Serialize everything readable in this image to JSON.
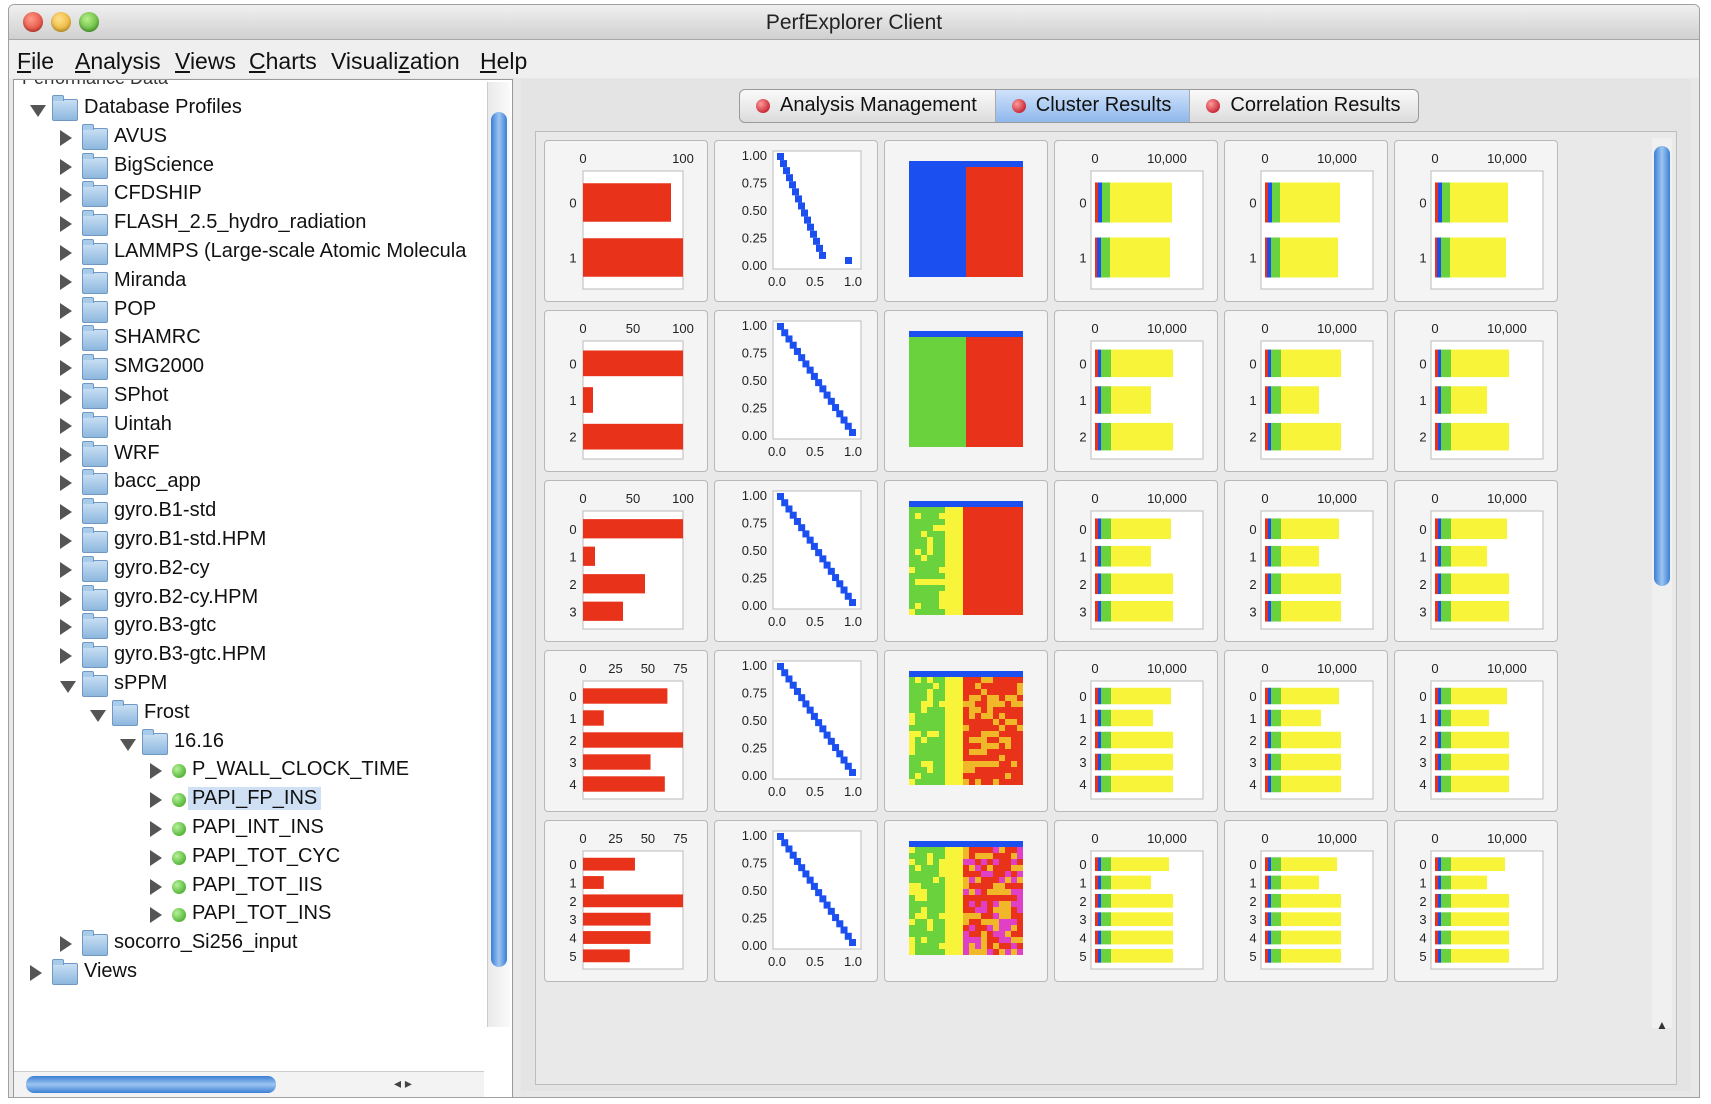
{
  "window": {
    "title": "PerfExplorer Client"
  },
  "menu": [
    {
      "label": "File",
      "u": "F",
      "rest": "ile"
    },
    {
      "label": "Analysis",
      "u": "A",
      "rest": "nalysis"
    },
    {
      "label": "Views",
      "u": "V",
      "rest": "iews"
    },
    {
      "label": "Charts",
      "u": "C",
      "rest": "harts"
    },
    {
      "label": "Visualization",
      "pre": "Visuali",
      "u": "z",
      "rest": "ation"
    },
    {
      "label": "Help",
      "u": "H",
      "rest": "elp"
    }
  ],
  "tree": {
    "partial_header": "Performance Data",
    "root": "Database Profiles",
    "apps": [
      "AVUS",
      "BigScience",
      "CFDSHIP",
      "FLASH_2.5_hydro_radiation",
      "LAMMPS (Large-scale Atomic Molecula",
      "Miranda",
      "POP",
      "SHAMRC",
      "SMG2000",
      "SPhot",
      "Uintah",
      "WRF",
      "bacc_app",
      "gyro.B1-std",
      "gyro.B1-std.HPM",
      "gyro.B2-cy",
      "gyro.B2-cy.HPM",
      "gyro.B3-gtc",
      "gyro.B3-gtc.HPM"
    ],
    "expanded_app": "sPPM",
    "experiment": "Frost",
    "trial": "16.16",
    "metrics": [
      "P_WALL_CLOCK_TIME",
      "PAPI_FP_INS",
      "PAPI_INT_INS",
      "PAPI_TOT_CYC",
      "PAPI_TOT_IIS",
      "PAPI_TOT_INS"
    ],
    "selected_metric": "PAPI_FP_INS",
    "after": [
      "socorro_Si256_input",
      "Views"
    ]
  },
  "tabs": [
    {
      "label": "Analysis Management",
      "active": false
    },
    {
      "label": "Cluster Results",
      "active": true
    },
    {
      "label": "Correlation Results",
      "active": false
    }
  ],
  "colors": {
    "red": "#e8321a",
    "blue": "#1c4ff0",
    "green": "#6ad23c",
    "yellow": "#f8f43a",
    "orange": "#f0b828",
    "magenta": "#e040c8"
  },
  "chart_data": [
    {
      "type": "bar",
      "row": 1,
      "categories": [
        "0",
        "1"
      ],
      "values": [
        88,
        100
      ],
      "ticks": [
        "0",
        "100"
      ],
      "xlim": [
        0,
        100
      ]
    },
    {
      "type": "bar",
      "row": 2,
      "categories": [
        "0",
        "1",
        "2"
      ],
      "values": [
        100,
        10,
        100
      ],
      "ticks": [
        "0",
        "50",
        "100"
      ],
      "xlim": [
        0,
        100
      ]
    },
    {
      "type": "bar",
      "row": 3,
      "categories": [
        "0",
        "1",
        "2",
        "3"
      ],
      "values": [
        100,
        12,
        62,
        40
      ],
      "ticks": [
        "0",
        "50",
        "100"
      ],
      "xlim": [
        0,
        100
      ]
    },
    {
      "type": "bar",
      "row": 4,
      "categories": [
        "0",
        "1",
        "2",
        "3",
        "4"
      ],
      "values": [
        65,
        16,
        77,
        52,
        63
      ],
      "ticks": [
        "0",
        "25",
        "50",
        "75"
      ],
      "xlim": [
        0,
        77
      ]
    },
    {
      "type": "bar",
      "row": 5,
      "categories": [
        "0",
        "1",
        "2",
        "3",
        "4",
        "5"
      ],
      "values": [
        40,
        16,
        77,
        52,
        52,
        36
      ],
      "ticks": [
        "0",
        "25",
        "50",
        "75"
      ],
      "xlim": [
        0,
        77
      ]
    },
    {
      "type": "scatter",
      "xticks": [
        "0.0",
        "0.5",
        "1.0"
      ],
      "yticks": [
        "0.00",
        "0.25",
        "0.50",
        "0.75",
        "1.00"
      ],
      "xlim": [
        0,
        1
      ],
      "ylim": [
        0,
        1
      ]
    },
    {
      "type": "heatmap",
      "note": "cluster membership"
    },
    {
      "type": "bar",
      "stacked": true,
      "ticks": [
        "0",
        "10,000"
      ],
      "rows": [
        {
          "categories": [
            "0",
            "1"
          ],
          "lengths": [
            [
              3,
              4,
              8,
              62
            ],
            [
              2,
              4,
              9,
              60
            ]
          ]
        },
        {
          "categories": [
            "0",
            "1",
            "2"
          ],
          "lengths": [
            [
              3,
              3,
              10,
              62
            ],
            [
              3,
              3,
              10,
              40
            ],
            [
              3,
              3,
              10,
              62
            ]
          ]
        },
        {
          "categories": [
            "0",
            "1",
            "2",
            "3"
          ],
          "lengths": [
            [
              3,
              3,
              10,
              60
            ],
            [
              3,
              3,
              10,
              40
            ],
            [
              3,
              3,
              10,
              62
            ],
            [
              3,
              3,
              10,
              62
            ]
          ]
        },
        {
          "categories": [
            "0",
            "1",
            "2",
            "3",
            "4"
          ],
          "lengths": [
            [
              3,
              3,
              10,
              60
            ],
            [
              3,
              3,
              10,
              42
            ],
            [
              3,
              3,
              10,
              62
            ],
            [
              3,
              3,
              10,
              62
            ],
            [
              3,
              3,
              10,
              62
            ]
          ]
        },
        {
          "categories": [
            "0",
            "1",
            "2",
            "3",
            "4",
            "5"
          ],
          "lengths": [
            [
              3,
              3,
              10,
              58
            ],
            [
              3,
              3,
              10,
              40
            ],
            [
              3,
              3,
              10,
              62
            ],
            [
              3,
              3,
              10,
              62
            ],
            [
              3,
              3,
              10,
              62
            ],
            [
              3,
              3,
              10,
              62
            ]
          ]
        }
      ]
    }
  ]
}
